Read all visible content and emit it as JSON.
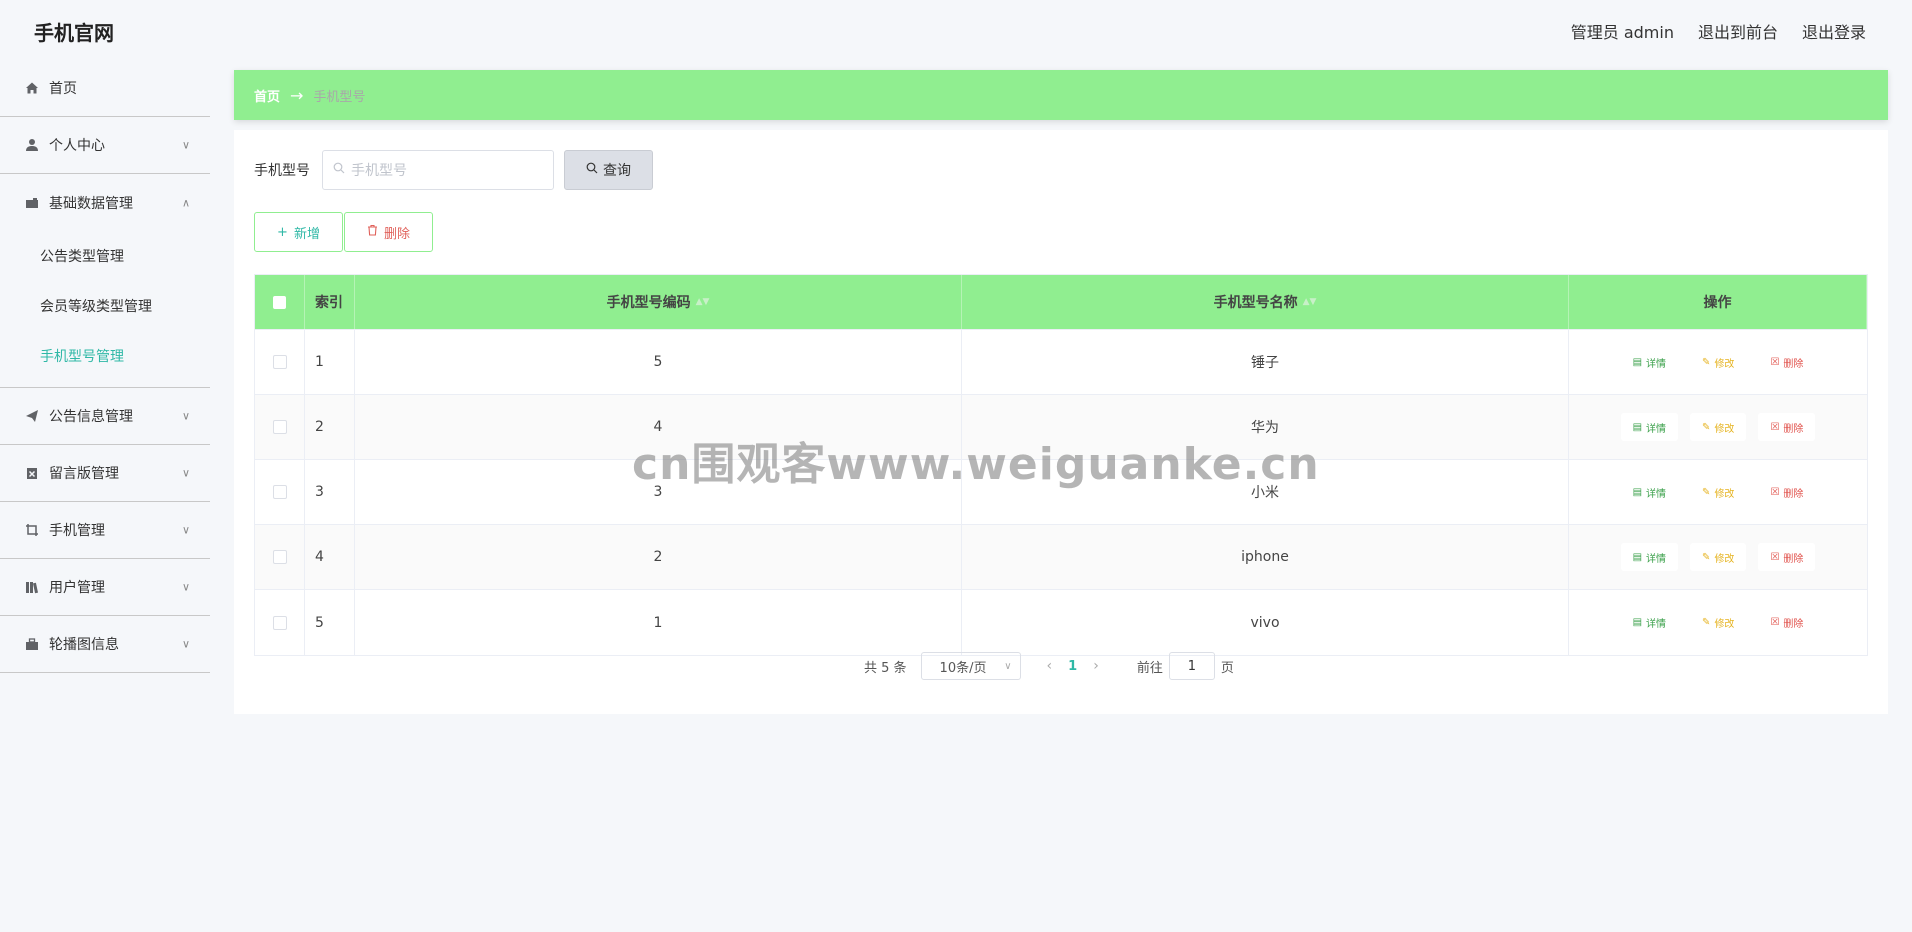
{
  "header": {
    "brand": "手机官网",
    "admin_label": "管理员 admin",
    "to_front_label": "退出到前台",
    "logout_label": "退出登录"
  },
  "sidebar": {
    "items": [
      {
        "label": "首页",
        "icon": "home-icon"
      },
      {
        "label": "个人中心",
        "icon": "user-icon"
      },
      {
        "label": "基础数据管理",
        "icon": "briefcase-icon",
        "open": true,
        "children": [
          {
            "label": "公告类型管理"
          },
          {
            "label": "会员等级类型管理"
          },
          {
            "label": "手机型号管理",
            "active": true
          }
        ]
      },
      {
        "label": "公告信息管理",
        "icon": "send-icon"
      },
      {
        "label": "留言版管理",
        "icon": "clipboard-icon"
      },
      {
        "label": "手机管理",
        "icon": "crop-icon"
      },
      {
        "label": "用户管理",
        "icon": "library-icon"
      },
      {
        "label": "轮播图信息",
        "icon": "toolbox-icon"
      }
    ]
  },
  "breadcrumb": {
    "home": "首页",
    "current": "手机型号"
  },
  "search": {
    "label": "手机型号",
    "placeholder": "手机型号",
    "query_label": "查询"
  },
  "actions": {
    "add_label": "新增",
    "delete_label": "删除"
  },
  "table": {
    "headers": {
      "index": "索引",
      "code": "手机型号编码",
      "name": "手机型号名称",
      "ops": "操作"
    },
    "rows": [
      {
        "index": "1",
        "code": "5",
        "name": "锤子"
      },
      {
        "index": "2",
        "code": "4",
        "name": "华为"
      },
      {
        "index": "3",
        "code": "3",
        "name": "小米"
      },
      {
        "index": "4",
        "code": "2",
        "name": "iphone"
      },
      {
        "index": "5",
        "code": "1",
        "name": "vivo"
      }
    ],
    "op_labels": {
      "detail": "详情",
      "edit": "修改",
      "delete": "删除"
    }
  },
  "pagination": {
    "total_text": "共 5 条",
    "page_size": "10条/页",
    "current_page": "1",
    "goto_label": "前往",
    "goto_value": "1",
    "page_suffix": "页"
  },
  "watermark": "cn围观客www.weiguanke.cn",
  "colors": {
    "accent_green": "#90ee90",
    "teal": "#2fb8a6",
    "danger": "#e0504a",
    "warning": "#e6b422",
    "success": "#3aa04a"
  }
}
